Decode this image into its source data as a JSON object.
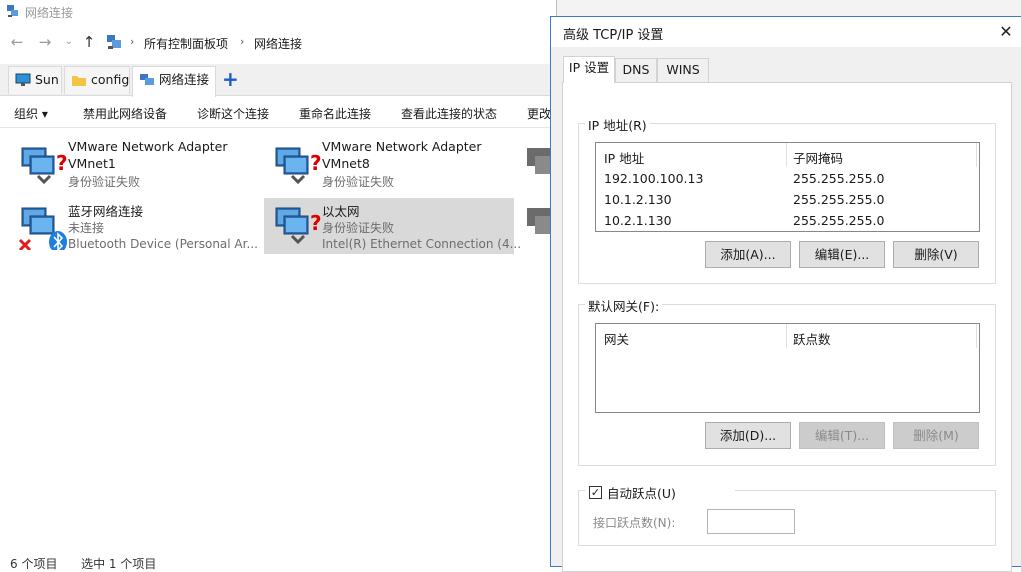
{
  "explorer": {
    "title": "网络连接",
    "breadcrumb": [
      "所有控制面板项",
      "网络连接"
    ],
    "tabs": [
      "Sun",
      "config",
      "网络连接"
    ],
    "commands": [
      "组织 ▾",
      "禁用此网络设备",
      "诊断这个连接",
      "重命名此连接",
      "查看此连接的状态",
      "更改"
    ],
    "items": [
      {
        "name": "VMware Network Adapter",
        "name2": "VMnet1",
        "status": "身份验证失败",
        "device": ""
      },
      {
        "name": "VMware Network Adapter",
        "name2": "VMnet8",
        "status": "身份验证失败",
        "device": ""
      },
      {
        "name": "蓝牙网络连接",
        "name2": "",
        "status": "未连接",
        "device": "Bluetooth Device (Personal Ar..."
      },
      {
        "name": "以太网",
        "name2": "",
        "status": "身份验证失败",
        "device": "Intel(R) Ethernet Connection (4..."
      }
    ],
    "status": {
      "count": "6 个项目",
      "selected": "选中 1 个项目"
    }
  },
  "dialog": {
    "title": "高级 TCP/IP 设置",
    "tabs": [
      "IP 设置",
      "DNS",
      "WINS"
    ],
    "ip_group": {
      "label": "IP 地址(R)",
      "columns": [
        "IP 地址",
        "子网掩码"
      ],
      "rows": [
        [
          "192.100.100.13",
          "255.255.255.0"
        ],
        [
          "10.1.2.130",
          "255.255.255.0"
        ],
        [
          "10.2.1.130",
          "255.255.255.0"
        ]
      ],
      "buttons": [
        "添加(A)...",
        "编辑(E)...",
        "删除(V)"
      ]
    },
    "gateway_group": {
      "label": "默认网关(F):",
      "columns": [
        "网关",
        "跃点数"
      ],
      "buttons": [
        "添加(D)...",
        "编辑(T)...",
        "删除(M)"
      ]
    },
    "auto_metric": {
      "checked": true,
      "label": "自动跃点(U)",
      "field_label": "接口跃点数(N):",
      "field_value": ""
    }
  }
}
